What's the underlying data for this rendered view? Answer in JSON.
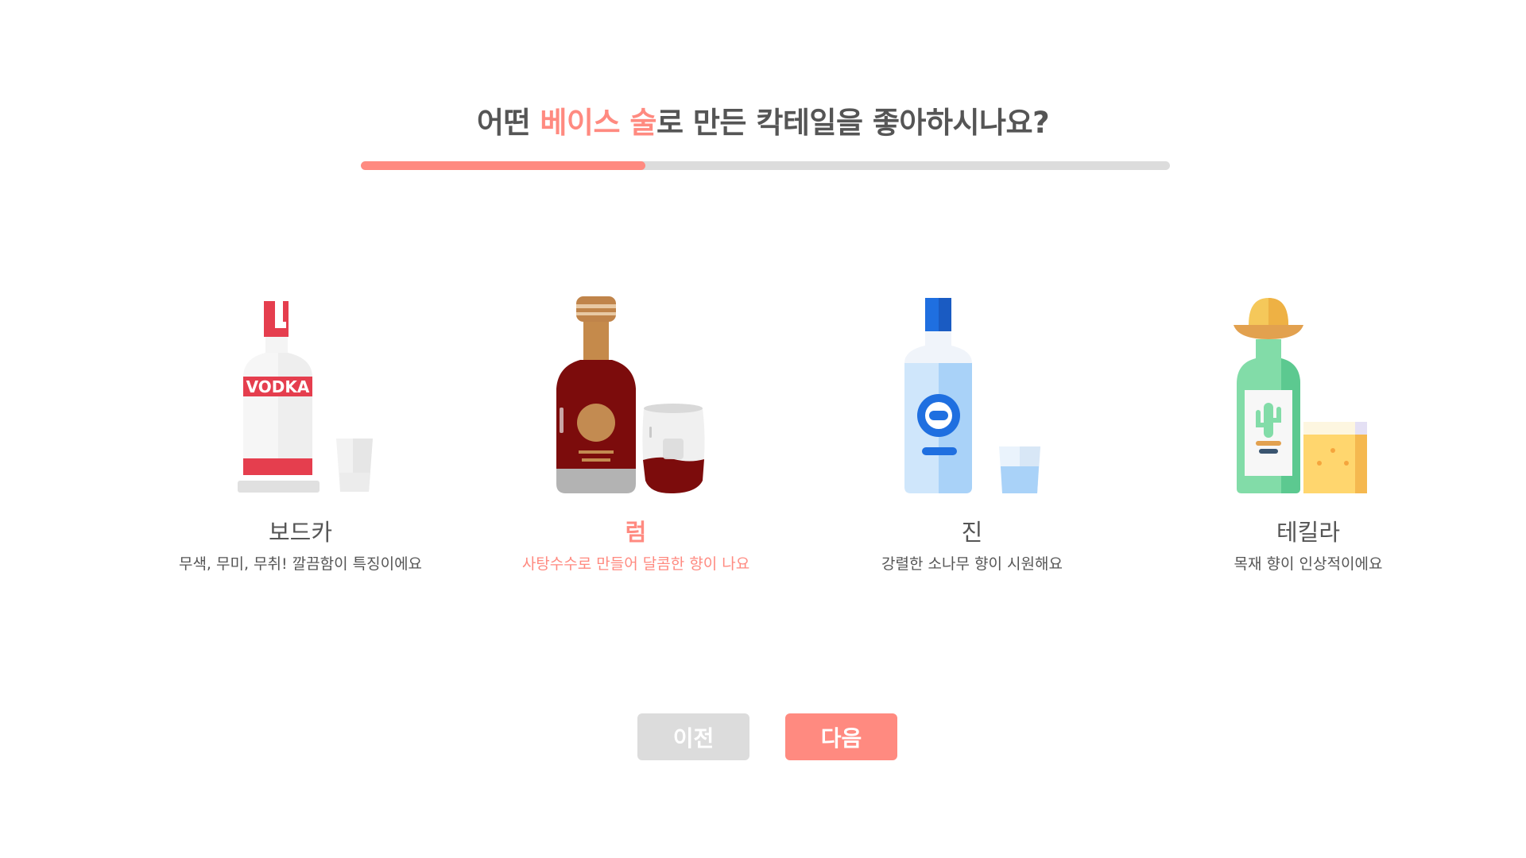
{
  "question": {
    "prefix": "어떤 ",
    "highlight": "베이스 술",
    "suffix": "로 만든 칵테일을 좋아하시나요?"
  },
  "progress": {
    "fraction": 0.352
  },
  "colors": {
    "accent": "#ff8a80",
    "inactive": "#dcdcdc",
    "text": "#555555"
  },
  "options": [
    {
      "name": "보드카",
      "description": "무색, 무미, 무취! 깔끔함이 특징이에요",
      "icon": "vodka-bottle-icon",
      "label_text": "VODKA",
      "selected": false
    },
    {
      "name": "럼",
      "description": "사탕수수로 만들어 달콤한 향이 나요",
      "icon": "rum-bottle-icon",
      "selected": true
    },
    {
      "name": "진",
      "description": "강렬한 소나무 향이 시원해요",
      "icon": "gin-bottle-icon",
      "selected": false
    },
    {
      "name": "테킬라",
      "description": "목재 향이 인상적이에요",
      "icon": "tequila-bottle-icon",
      "selected": false
    }
  ],
  "buttons": {
    "prev": "이전",
    "next": "다음"
  }
}
